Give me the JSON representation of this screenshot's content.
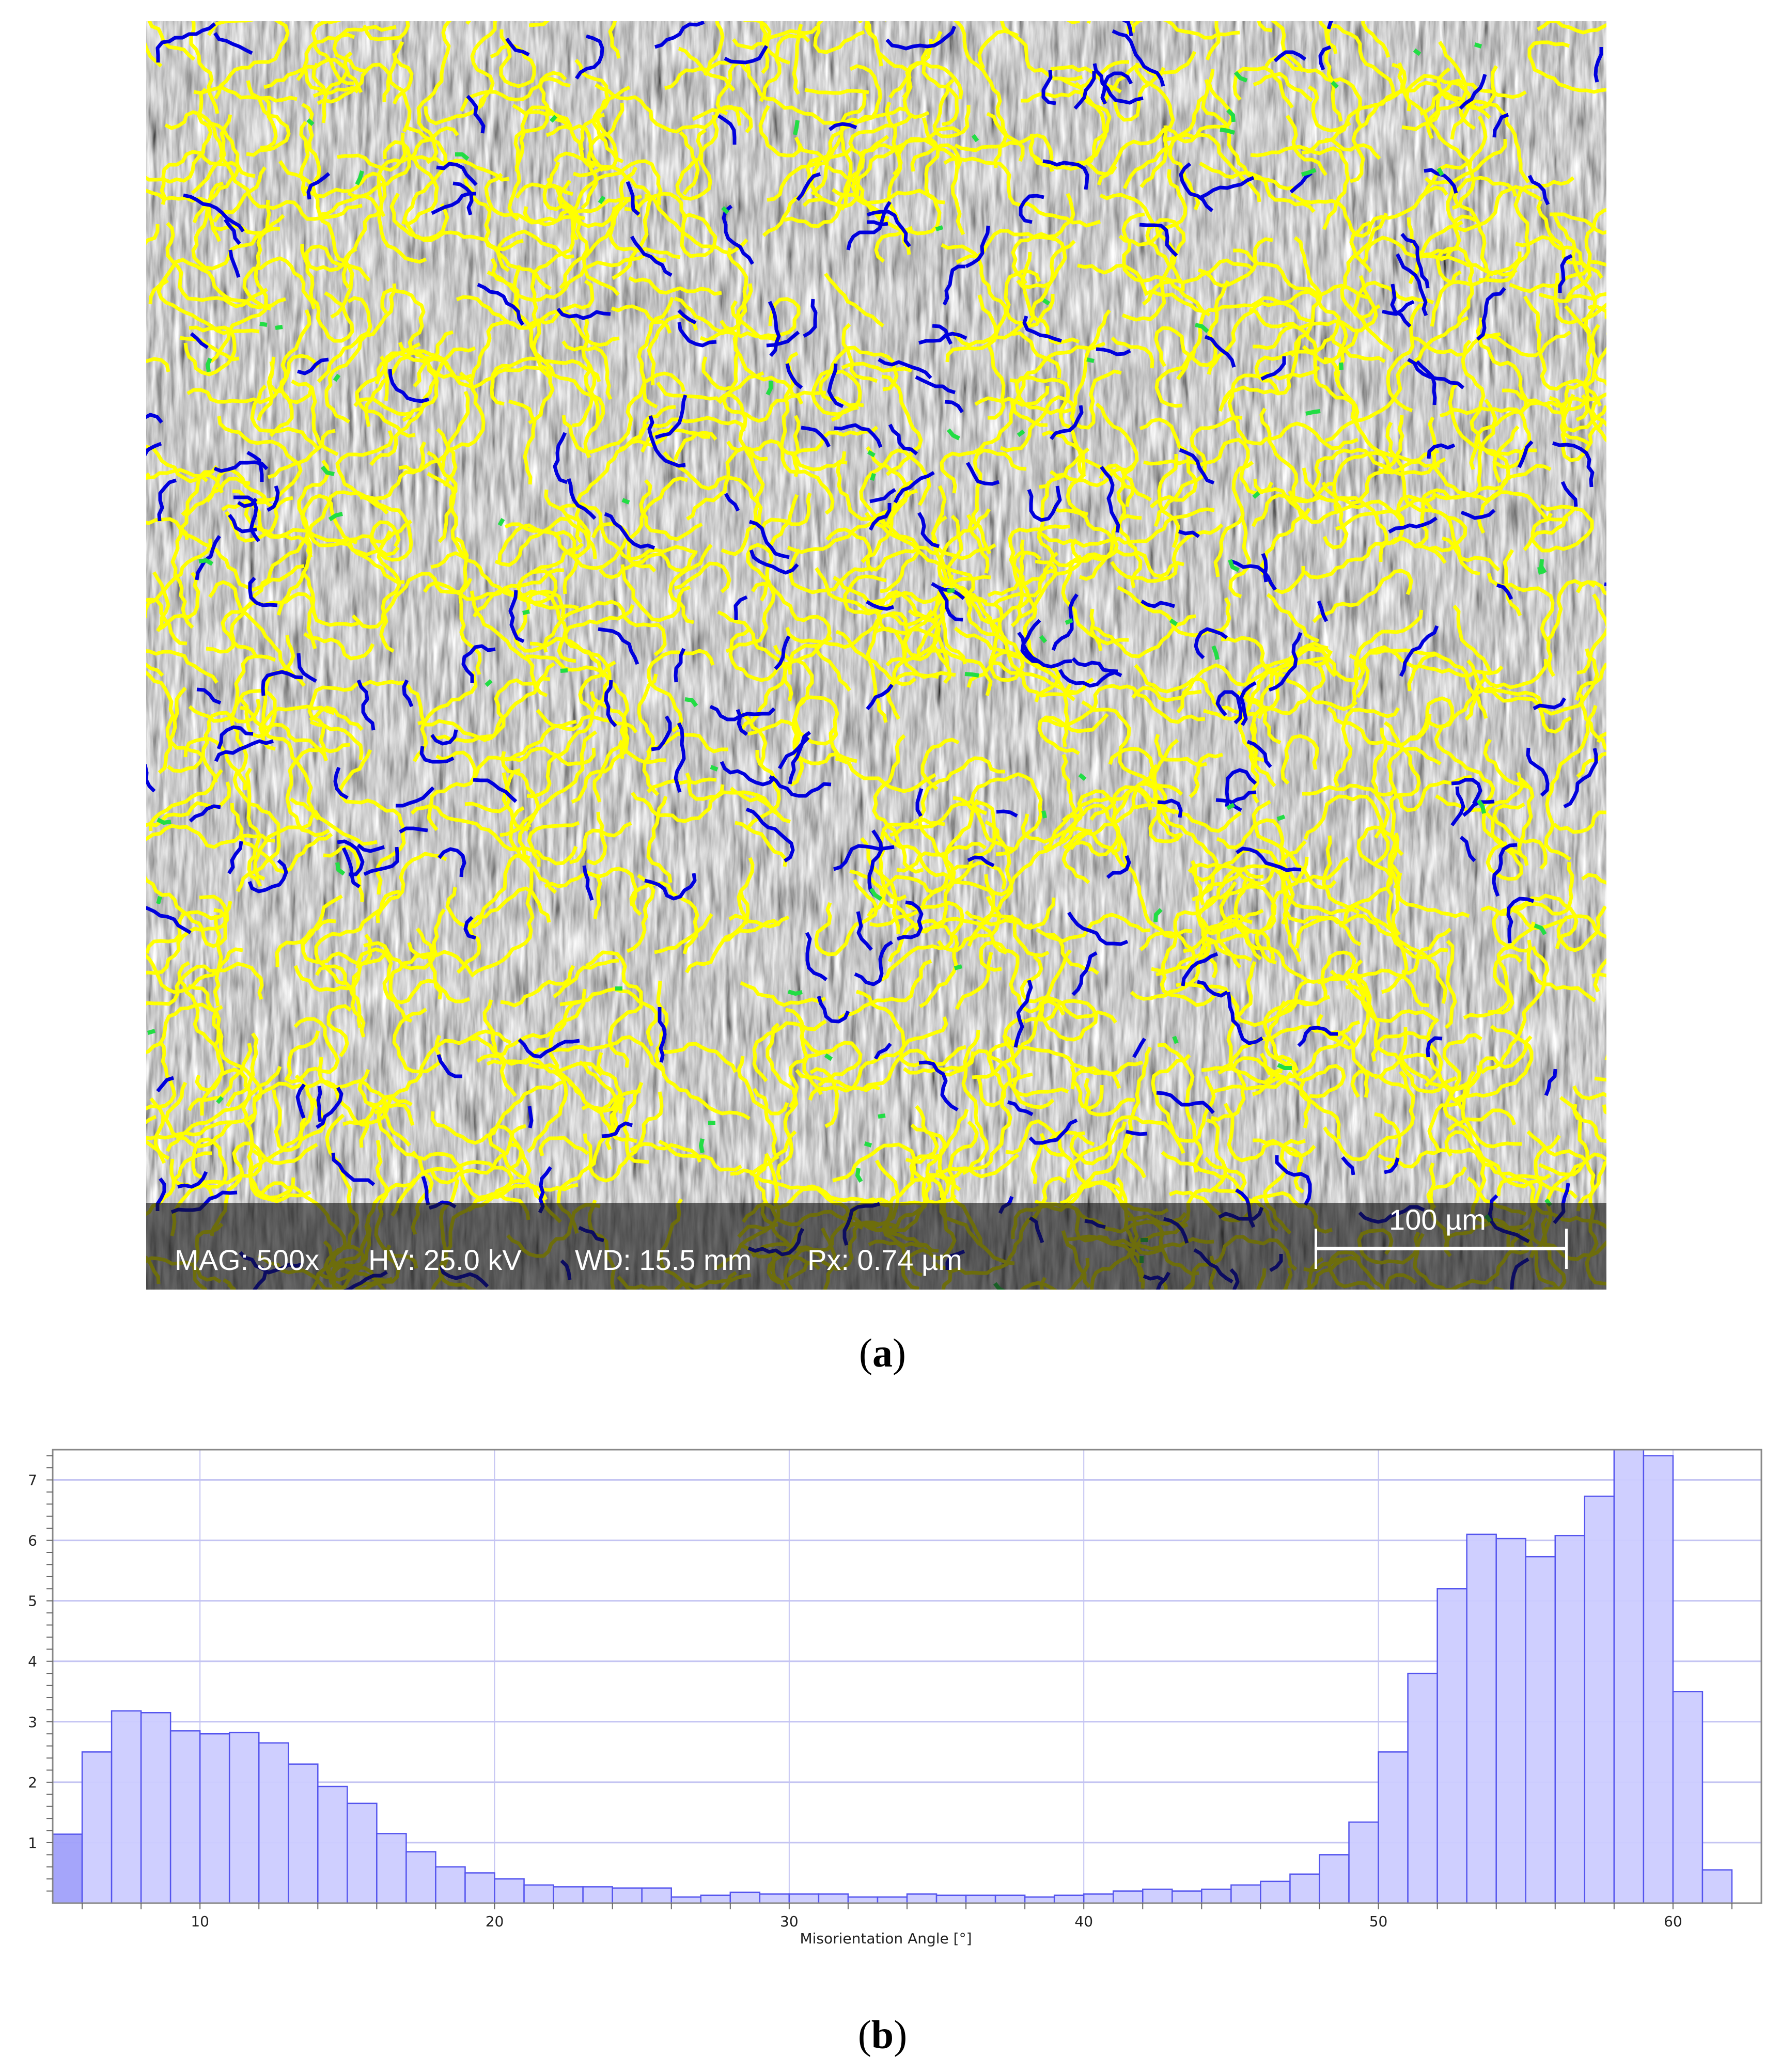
{
  "figure_a": {
    "caption_letter": "a",
    "info": {
      "mag": "MAG: 500x",
      "hv": "HV: 25.0 kV",
      "wd": "WD: 15.5 mm",
      "px": "Px: 0.74 µm"
    },
    "scale_bar_label": "100 µm",
    "boundary_colors": {
      "high_angle": "#ffff00",
      "low_angle": "#0000dd",
      "other": "#22dd44"
    }
  },
  "figure_b": {
    "caption_letter": "b"
  },
  "chart_data": {
    "type": "bar",
    "title": "",
    "xlabel": "Misorientation Angle [°]",
    "ylabel": "",
    "xlim": [
      5,
      63
    ],
    "ylim": [
      0,
      7.5
    ],
    "xticks": [
      10,
      20,
      30,
      40,
      50,
      60
    ],
    "yticks": [
      1,
      2,
      3,
      4,
      5,
      6,
      7
    ],
    "grid": true,
    "bin_width": 1,
    "bin_starts": [
      5,
      6,
      7,
      8,
      9,
      10,
      11,
      12,
      13,
      14,
      15,
      16,
      17,
      18,
      19,
      20,
      21,
      22,
      23,
      24,
      25,
      26,
      27,
      28,
      29,
      30,
      31,
      32,
      33,
      34,
      35,
      36,
      37,
      38,
      39,
      40,
      41,
      42,
      43,
      44,
      45,
      46,
      47,
      48,
      49,
      50,
      51,
      52,
      53,
      54,
      55,
      56,
      57,
      58,
      59,
      60,
      61
    ],
    "values": [
      1.14,
      2.5,
      3.18,
      3.15,
      2.85,
      2.8,
      2.82,
      2.65,
      2.3,
      1.93,
      1.65,
      1.15,
      0.85,
      0.6,
      0.5,
      0.4,
      0.3,
      0.27,
      0.27,
      0.25,
      0.25,
      0.1,
      0.13,
      0.18,
      0.15,
      0.15,
      0.15,
      0.1,
      0.1,
      0.15,
      0.13,
      0.13,
      0.13,
      0.1,
      0.13,
      0.15,
      0.2,
      0.23,
      0.2,
      0.23,
      0.3,
      0.36,
      0.48,
      0.8,
      1.34,
      2.5,
      3.8,
      5.2,
      6.1,
      6.03,
      5.73,
      6.08,
      6.73,
      7.6,
      7.4,
      3.5,
      0.55
    ],
    "colors": {
      "bar_fill": "#ccccff",
      "bar_edge": "#5555ee",
      "first_bar_fill": "#a0a0fa",
      "grid": "#c4c4f2",
      "axis": "#888888"
    }
  }
}
